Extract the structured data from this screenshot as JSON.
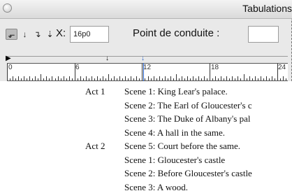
{
  "window": {
    "title": "Tabulations"
  },
  "toolbar": {
    "tab_buttons": [
      {
        "name": "left-justified",
        "glyph": "⬐",
        "active": true
      },
      {
        "name": "center-justified",
        "glyph": "↓"
      },
      {
        "name": "right-justified",
        "glyph": "↴"
      },
      {
        "name": "align-on-decimal",
        "glyph": "⇣"
      }
    ],
    "x_label": "X:",
    "x_value": "16p0",
    "leader_label": "Point de conduite :",
    "leader_value": ""
  },
  "ruler": {
    "labels": [
      "0",
      "6",
      "12",
      "18",
      "24"
    ]
  },
  "document": {
    "acts": [
      {
        "label": "Act 1",
        "row": 0
      },
      {
        "label": "Act 2",
        "row": 5
      }
    ],
    "scenes": [
      "Scene 1: King Lear's palace.",
      "Scene 2: The Earl of Gloucester's c",
      "Scene 3: The Duke of Albany's pal",
      "Scene 4: A hall in the same.",
      "Scene 5: Court before the same.",
      "Scene 1: Gloucester's castle",
      "Scene 2: Before Gloucester's castle",
      "Scene 3: A wood."
    ]
  }
}
